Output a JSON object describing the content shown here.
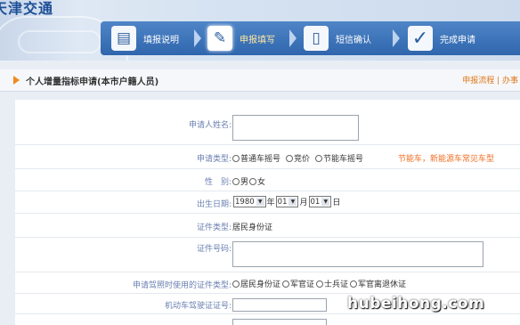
{
  "app": {
    "logo_text": "天津交通"
  },
  "steps": [
    {
      "icon": "document-icon",
      "label": "填报说明",
      "active": false
    },
    {
      "icon": "form-edit-icon",
      "label": "申报填写",
      "active": true
    },
    {
      "icon": "message-icon",
      "label": "短信确认",
      "active": false
    },
    {
      "icon": "checkmark-icon",
      "label": "完成申请",
      "active": false
    }
  ],
  "page": {
    "title": "个人增量指标申请(本市户籍人员)",
    "links": "申报流程 | 办事"
  },
  "form": {
    "name_label": "申请人姓名:",
    "name_value": "",
    "type_label": "申请类型:",
    "type_options": [
      "普通车摇号",
      "竞价",
      "节能车摇号"
    ],
    "type_hint": "节能车，新能源车常见车型",
    "gender_label": "性　别:",
    "gender_options": [
      "男",
      "女"
    ],
    "birth_label": "出生日期:",
    "birth_year": "1980",
    "birth_year_unit": "年",
    "birth_month": "01",
    "birth_month_unit": "月",
    "birth_day": "01",
    "birth_day_unit": "日",
    "id_type_label": "证件类型:",
    "id_type_value": "居民身份证",
    "id_number_label": "证件号码:",
    "id_number_value": "",
    "license_id_type_label": "申请驾照时使用的证件类型:",
    "license_id_options": [
      "居民身份证",
      "军官证",
      "士兵证",
      "军官离退休证"
    ],
    "license_number_label": "机动车驾驶证证号:",
    "license_number_value": ""
  },
  "watermark": "hubeihong.com"
}
